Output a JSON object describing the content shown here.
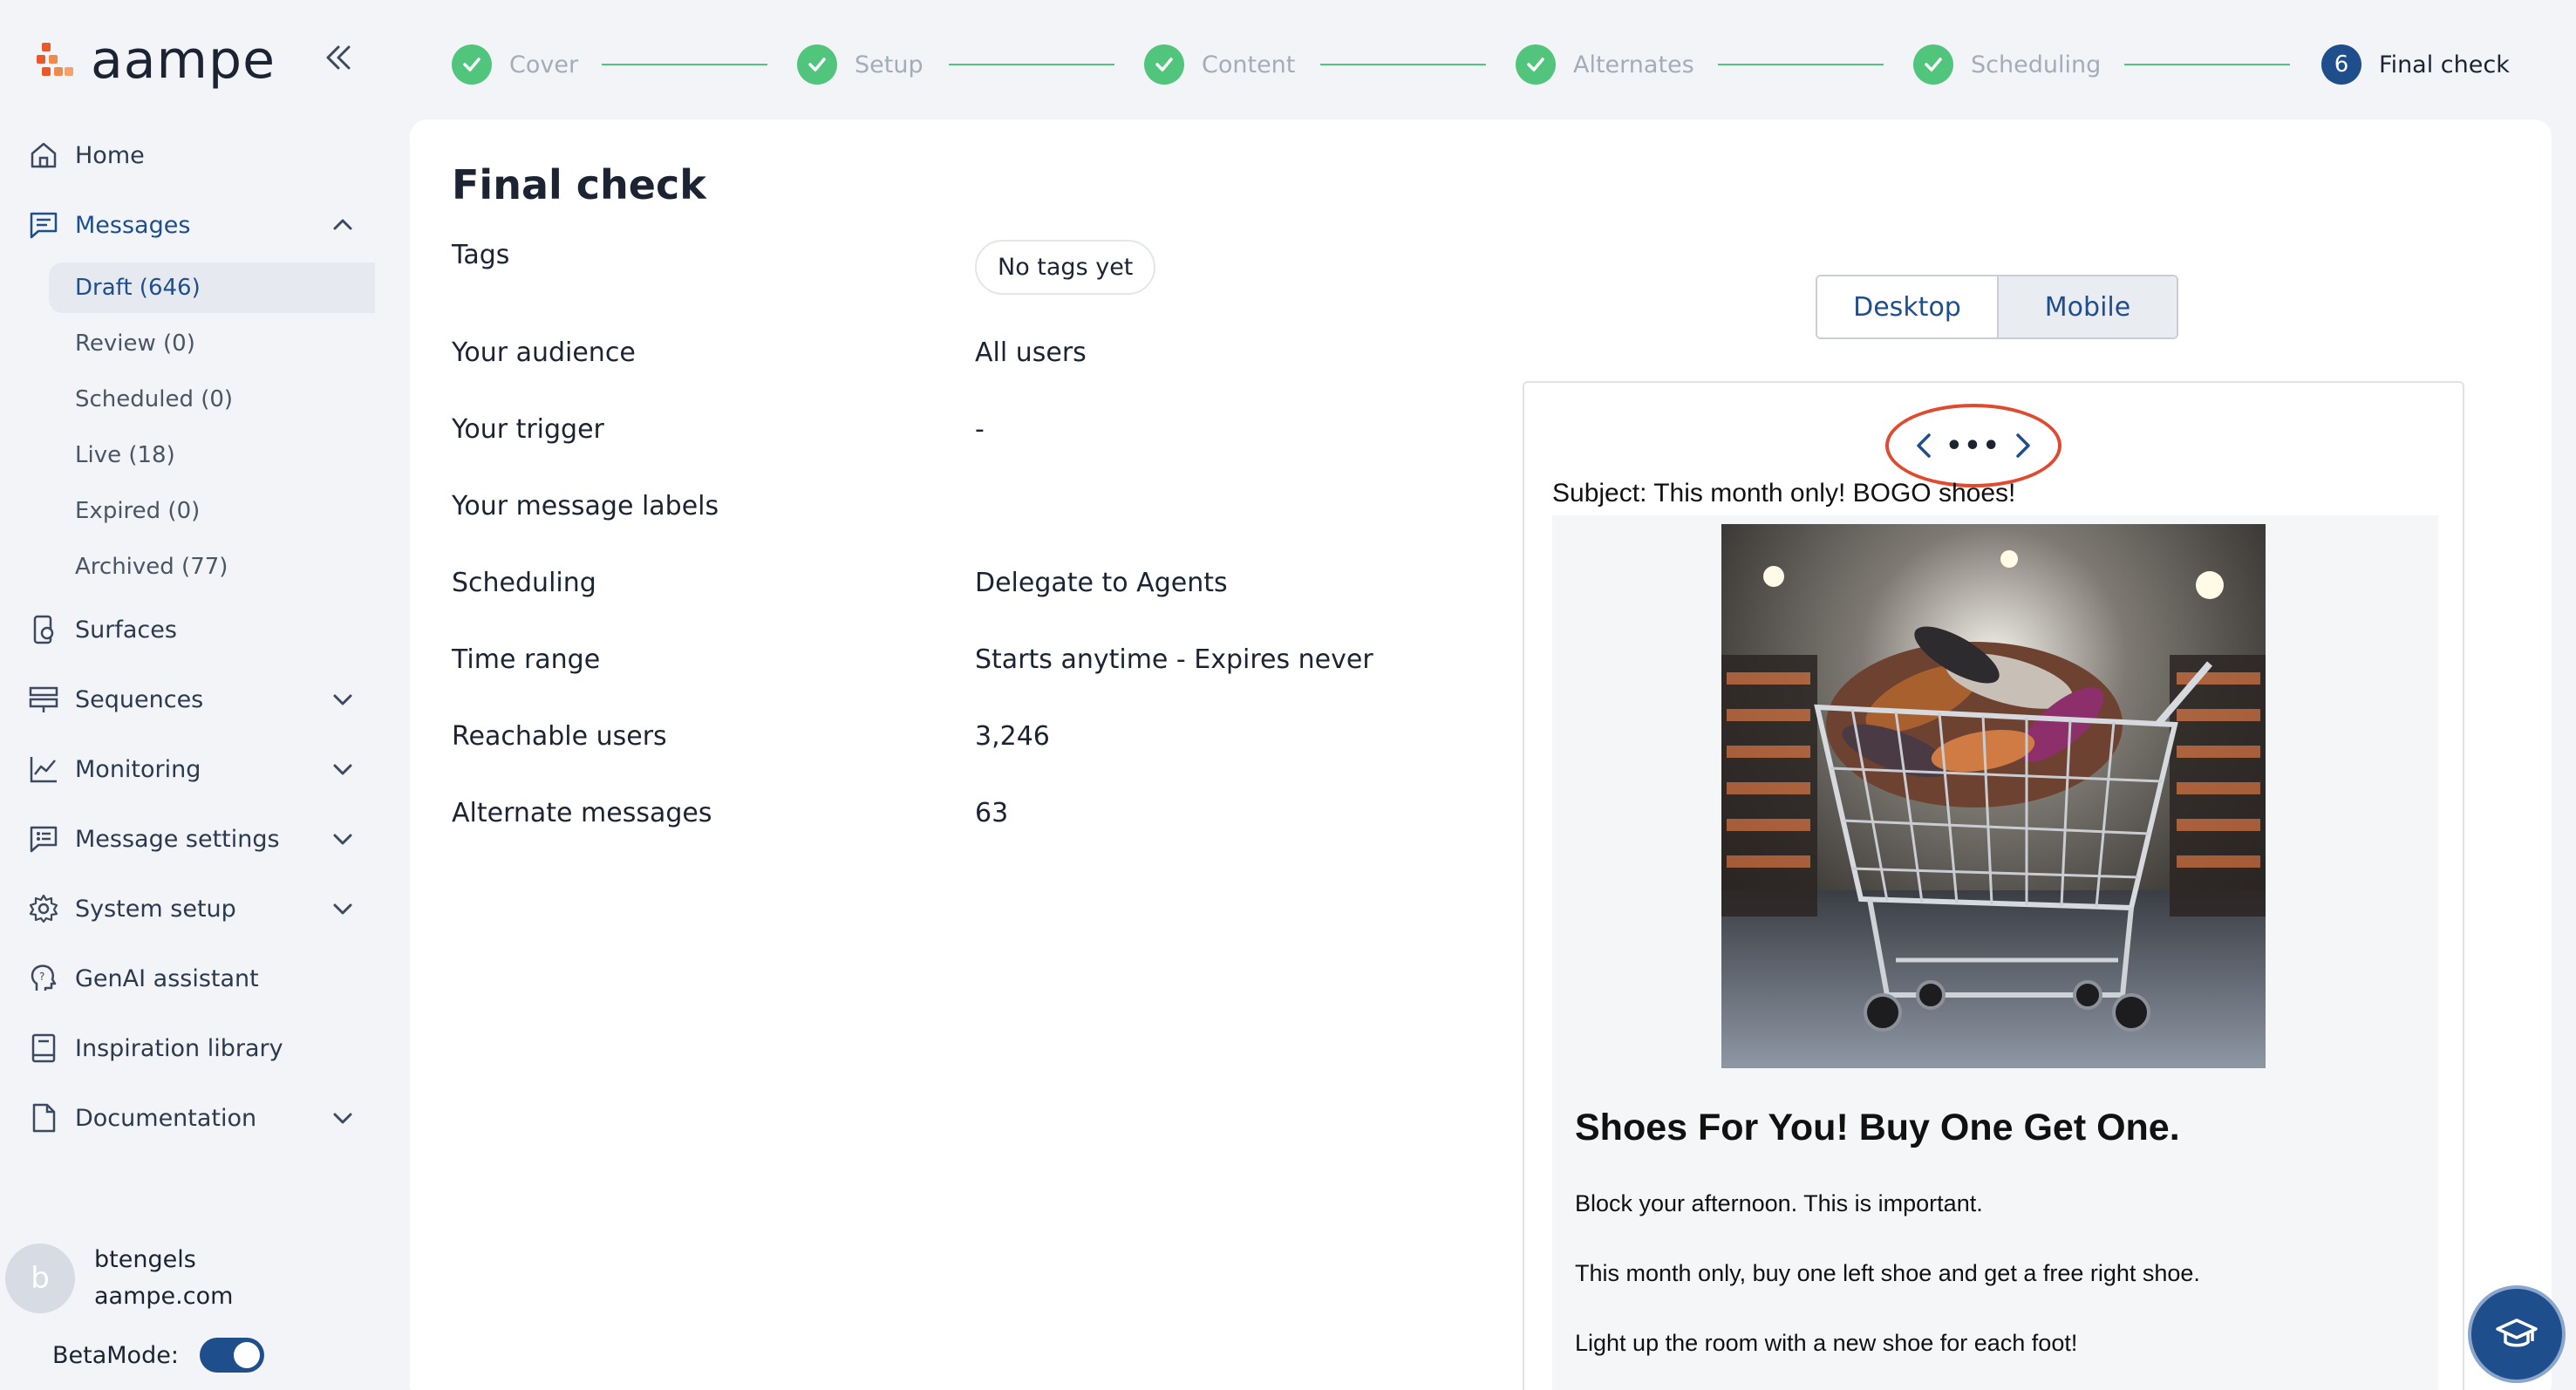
{
  "brand": {
    "name": "aampe"
  },
  "sidebar": {
    "items": [
      {
        "label": "Home",
        "icon": "home-icon"
      },
      {
        "label": "Messages",
        "icon": "messages-icon",
        "expanded": true
      },
      {
        "label": "Surfaces",
        "icon": "surfaces-icon"
      },
      {
        "label": "Sequences",
        "icon": "sequences-icon"
      },
      {
        "label": "Monitoring",
        "icon": "monitoring-icon"
      },
      {
        "label": "Message settings",
        "icon": "message-settings-icon"
      },
      {
        "label": "System setup",
        "icon": "gear-icon"
      },
      {
        "label": "GenAI assistant",
        "icon": "genai-icon"
      },
      {
        "label": "Inspiration library",
        "icon": "book-icon"
      },
      {
        "label": "Documentation",
        "icon": "document-icon"
      }
    ],
    "messages_sub": [
      {
        "label": "Draft (646)"
      },
      {
        "label": "Review (0)"
      },
      {
        "label": "Scheduled (0)"
      },
      {
        "label": "Live (18)"
      },
      {
        "label": "Expired (0)"
      },
      {
        "label": "Archived (77)"
      }
    ]
  },
  "user": {
    "initial": "b",
    "name": "btengels",
    "domain": "aampe.com"
  },
  "beta": {
    "label": "BetaMode:",
    "enabled": true
  },
  "stepper": {
    "steps": [
      {
        "label": "Cover",
        "status": "done"
      },
      {
        "label": "Setup",
        "status": "done"
      },
      {
        "label": "Content",
        "status": "done"
      },
      {
        "label": "Alternates",
        "status": "done"
      },
      {
        "label": "Scheduling",
        "status": "done"
      },
      {
        "label": "Final check",
        "status": "current",
        "number": "6"
      }
    ]
  },
  "main": {
    "title": "Final check",
    "rows": [
      {
        "label": "Tags",
        "value": "No tags yet"
      },
      {
        "label": "Your audience",
        "value": "All users"
      },
      {
        "label": "Your trigger",
        "value": "-"
      },
      {
        "label": "Your message labels",
        "value": ""
      },
      {
        "label": "Scheduling",
        "value": "Delegate to Agents"
      },
      {
        "label": "Time range",
        "value": "Starts anytime - Expires never"
      },
      {
        "label": "Reachable users",
        "value": "3,246"
      },
      {
        "label": "Alternate messages",
        "value": "63"
      }
    ]
  },
  "preview": {
    "view_options": [
      "Desktop",
      "Mobile"
    ],
    "selected_view": "Mobile",
    "pager_dots": "•••",
    "subject": "Subject: This month only! BOGO shoes!",
    "heading": "Shoes For You! Buy One Get One.",
    "paragraphs": [
      "Block your afternoon. This is important.",
      "This month only, buy one left shoe and get a free right shoe.",
      "Light up the room with a new shoe for each foot!"
    ]
  },
  "colors": {
    "accent": "#1f4e8c",
    "success": "#52c57d",
    "highlight_ring": "#e04a2f",
    "brand_orange": "#e8582b"
  }
}
